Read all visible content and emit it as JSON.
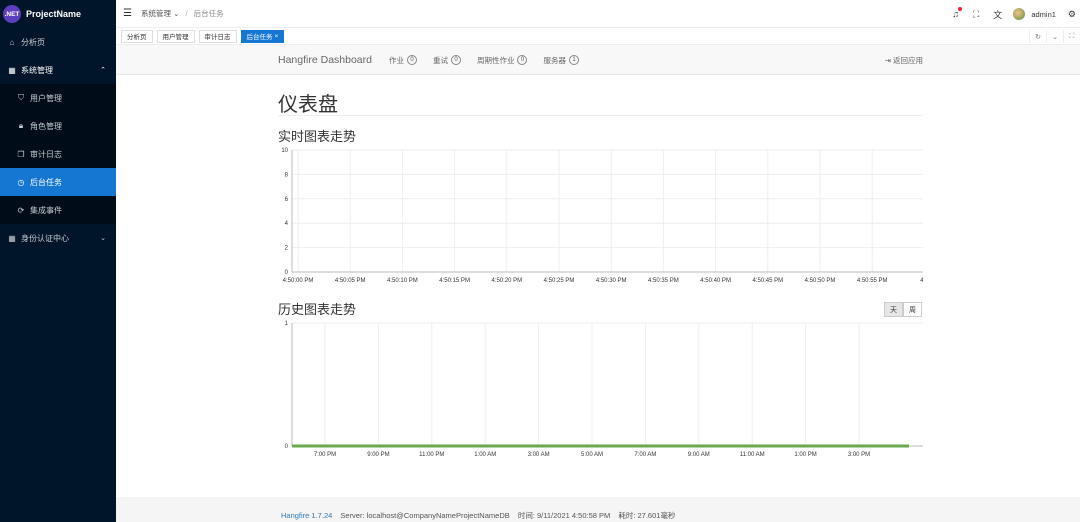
{
  "brand": {
    "logo": ".NET",
    "name": "ProjectName"
  },
  "sidebar": {
    "items": [
      {
        "icon": "bank-icon",
        "label": "分析页"
      },
      {
        "icon": "appstore-icon",
        "label": "系统管理"
      },
      {
        "icon": "skin-icon",
        "label": "用户管理"
      },
      {
        "icon": "lock-icon",
        "label": "角色管理"
      },
      {
        "icon": "snippets-icon",
        "label": "审计日志"
      },
      {
        "icon": "clock-icon",
        "label": "后台任务"
      },
      {
        "icon": "sync-icon",
        "label": "集成事件"
      },
      {
        "icon": "appstore-icon",
        "label": "身份认证中心"
      }
    ]
  },
  "header": {
    "breadcrumb": {
      "parent": "系统管理",
      "current": "后台任务"
    },
    "username": "admin1"
  },
  "tabs": [
    {
      "label": "分析页"
    },
    {
      "label": "用户管理"
    },
    {
      "label": "审计日志"
    },
    {
      "label": "后台任务",
      "close": "×"
    }
  ],
  "hangfire": {
    "brand": "Hangfire Dashboard",
    "nav": [
      {
        "label": "作业",
        "count": "0"
      },
      {
        "label": "重试",
        "count": "0"
      },
      {
        "label": "周期性作业",
        "count": "0"
      },
      {
        "label": "服务器",
        "count": "1"
      }
    ],
    "back": "返回应用",
    "page_title": "仪表盘",
    "realtime_title": "实时图表走势",
    "history_title": "历史图表走势",
    "toggle": {
      "day": "天",
      "week": "周"
    }
  },
  "footer": {
    "version": "Hangfire 1.7.24",
    "server": "Server: localhost@CompanyNameProjectNameDB",
    "time": "时间: 9/11/2021 4:50:58 PM",
    "elapsed": "耗时: 27.601毫秒"
  },
  "colors": {
    "sidebar_bg": "#001529",
    "active": "#1677d3",
    "history_line": "#6aa84f"
  },
  "chart_data": [
    {
      "type": "line",
      "title": "实时图表走势",
      "x": [
        "4:50:00 PM",
        "4:50:05 PM",
        "4:50:10 PM",
        "4:50:15 PM",
        "4:50:20 PM",
        "4:50:25 PM",
        "4:50:30 PM",
        "4:50:35 PM",
        "4:50:40 PM",
        "4:50:45 PM",
        "4:50:50 PM",
        "4:50:55 PM",
        "4:5"
      ],
      "yticks": [
        "0",
        "2",
        "4",
        "6",
        "8",
        "10"
      ],
      "ylim": [
        0,
        10
      ],
      "series": [],
      "grid": true
    },
    {
      "type": "line",
      "title": "历史图表走势",
      "x": [
        "7:00 PM",
        "9:00 PM",
        "11:00 PM",
        "1:00 AM",
        "3:00 AM",
        "5:00 AM",
        "7:00 AM",
        "9:00 AM",
        "11:00 AM",
        "1:00 PM",
        "3:00 PM"
      ],
      "yticks": [
        "0",
        "1"
      ],
      "ylim": [
        0,
        1
      ],
      "series": [
        {
          "values": [
            0,
            0,
            0,
            0,
            0,
            0,
            0,
            0,
            0,
            0,
            0
          ]
        }
      ],
      "grid": true
    }
  ]
}
